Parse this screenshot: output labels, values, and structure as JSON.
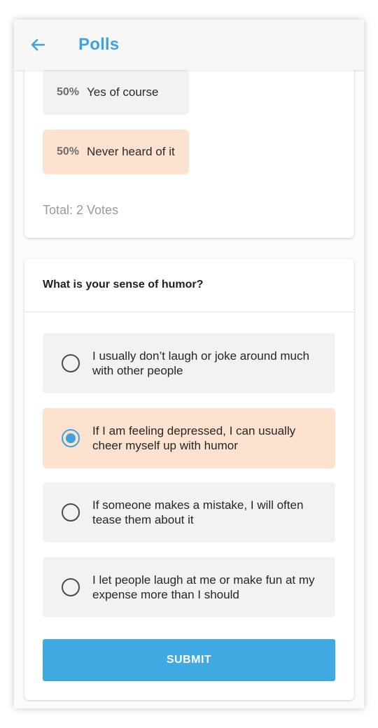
{
  "header": {
    "title": "Polls",
    "back_icon": "arrow-left-icon",
    "accent_color": "#3fa2dc"
  },
  "results_poll": {
    "results": [
      {
        "percent": "50%",
        "label": "Yes of course"
      },
      {
        "percent": "50%",
        "label": "Never heard of it"
      }
    ],
    "total": "Total: 2 Votes"
  },
  "question_poll": {
    "question": "What is your sense of humor?",
    "options": [
      {
        "label": "I usually don’t laugh or joke around much with other people",
        "selected": false
      },
      {
        "label": "If I am feeling depressed, I can usually cheer myself up with humor",
        "selected": true
      },
      {
        "label": "If someone makes a mistake, I will often tease them about it",
        "selected": false
      },
      {
        "label": "I let people laugh at me or make fun at my expense more than I should",
        "selected": false
      }
    ],
    "submit_label": "SUBMIT",
    "highlight_color": "#fde3cf",
    "button_color": "#3fa9e2"
  }
}
